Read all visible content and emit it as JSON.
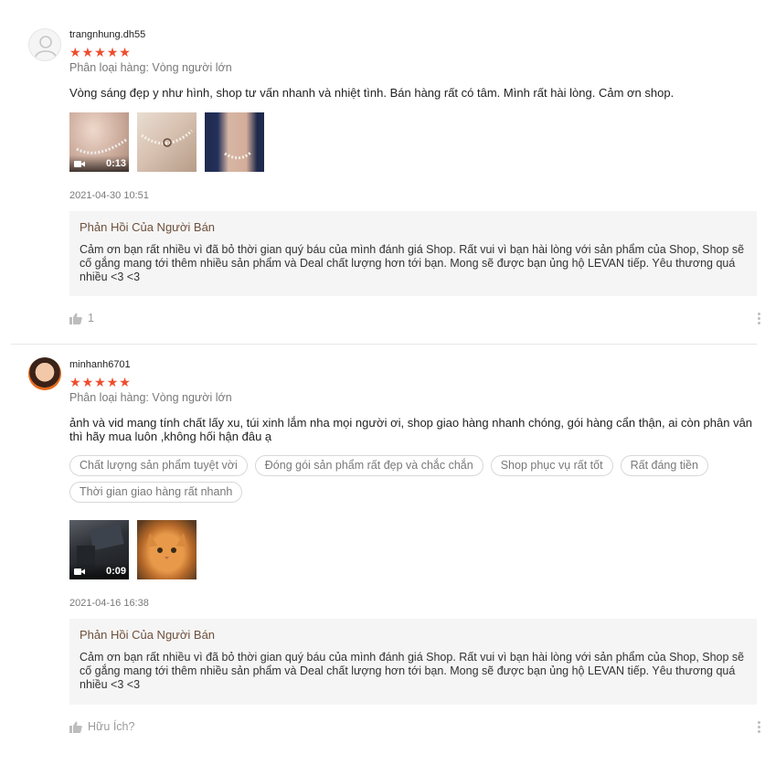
{
  "reviews": [
    {
      "username": "trangnhung.dh55",
      "rating": 5,
      "variation": "Phân loại hàng: Vòng người lớn",
      "comment": "Vòng sáng đẹp y như hình, shop tư vấn nhanh và nhiệt tình. Bán hàng rất có tâm. Mình rất hài lòng. Cảm ơn shop.",
      "media": [
        {
          "type": "video",
          "duration": "0:13",
          "icon": "video-camera-icon"
        },
        {
          "type": "image"
        },
        {
          "type": "image"
        }
      ],
      "timestamp": "2021-04-30 10:51",
      "seller_reply": {
        "title": "Phản Hồi Của Người Bán",
        "text": "Cảm ơn bạn rất nhiều vì đã bỏ thời gian quý báu của mình đánh giá Shop. Rất vui vì bạn hài lòng với sản phẩm của Shop, Shop sẽ cố gắng mang tới thêm nhiều sản phẩm và Deal chất lượng hơn tới bạn. Mong sẽ được bạn ủng hộ LEVAN tiếp. Yêu thương quá nhiều <3 <3"
      },
      "like_label": "1"
    },
    {
      "username": "minhanh6701",
      "rating": 5,
      "variation": "Phân loại hàng: Vòng người lớn",
      "comment": "ảnh và vid mang tính chất lấy xu, túi xinh lắm nha mọi người ơi, shop giao hàng nhanh chóng, gói hàng cẩn thận, ai còn phân vân thì hãy mua luôn ,không hối hận đâu ạ",
      "tags": [
        "Chất lượng sản phẩm tuyệt vời",
        "Đóng gói sản phẩm rất đẹp và chắc chắn",
        "Shop phục vụ rất tốt",
        "Rất đáng tiền",
        "Thời gian giao hàng rất nhanh"
      ],
      "media": [
        {
          "type": "video",
          "duration": "0:09",
          "icon": "video-camera-icon"
        },
        {
          "type": "image"
        }
      ],
      "timestamp": "2021-04-16 16:38",
      "seller_reply": {
        "title": "Phản Hồi Của Người Bán",
        "text": "Cảm ơn bạn rất nhiều vì đã bỏ thời gian quý báu của mình đánh giá Shop. Rất vui vì bạn hài lòng với sản phẩm của Shop, Shop sẽ cố gắng mang tới thêm nhiều sản phẩm và Deal chất lượng hơn tới bạn. Mong sẽ được bạn ủng hộ LEVAN tiếp. Yêu thương quá nhiều <3 <3"
      },
      "like_label": "Hữu Ích?"
    }
  ],
  "colors": {
    "star": "#ee4d2d",
    "reply_background": "#f5f5f5",
    "reply_title": "#6e503c"
  }
}
